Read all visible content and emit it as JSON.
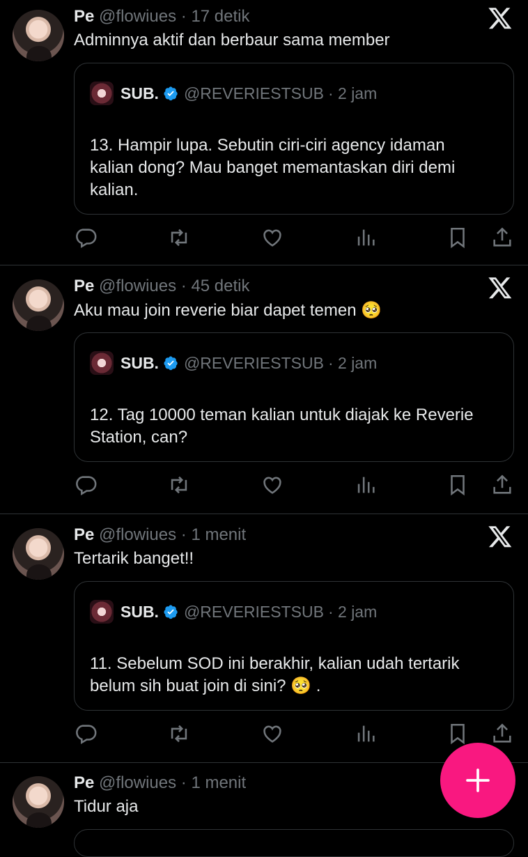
{
  "tweets": [
    {
      "name": "Pe",
      "handle": "@flowiues",
      "time": "· 17 detik",
      "text": "Adminnya aktif dan berbaur sama member",
      "quote": {
        "name": "SUB.",
        "handle": "@REVERIESTSUB",
        "time": "· 2 jam",
        "lines": [
          "13. Hampir lupa. Sebutin ciri-ciri agency idaman",
          "kalian dong? Mau banget memantaskan diri demi",
          "kalian."
        ]
      }
    },
    {
      "name": "Pe",
      "handle": "@flowiues",
      "time": "· 45 detik",
      "text": "Aku mau join reverie biar dapet temen 🥺",
      "quote": {
        "name": "SUB.",
        "handle": "@REVERIESTSUB",
        "time": "· 2 jam",
        "lines": [
          "12. Tag 10000 teman kalian untuk diajak ke Reverie",
          "Station, can?"
        ]
      }
    },
    {
      "name": "Pe",
      "handle": "@flowiues",
      "time": "· 1 menit",
      "text": "Tertarik banget!!",
      "quote": {
        "name": "SUB.",
        "handle": "@REVERIESTSUB",
        "time": "· 2 jam",
        "lines": [
          "11. Sebelum SOD ini berakhir, kalian udah tertarik",
          "belum sih buat join di sini? 🥺 ."
        ]
      }
    },
    {
      "name": "Pe",
      "handle": "@flowiues",
      "time": "· 1 menit",
      "text": "Tidur aja"
    }
  ],
  "icons": {
    "reply": "reply-icon",
    "retweet": "retweet-icon",
    "like": "heart-icon",
    "views": "views-icon",
    "bookmark": "bookmark-icon",
    "share": "share-icon",
    "source": "x-logo-icon",
    "compose": "plus-icon"
  },
  "colors": {
    "background": "#000000",
    "text": "#e7e9ea",
    "muted": "#71767b",
    "border": "#2f3336",
    "verified": "#1d9bf0",
    "fab": "#f91880"
  }
}
